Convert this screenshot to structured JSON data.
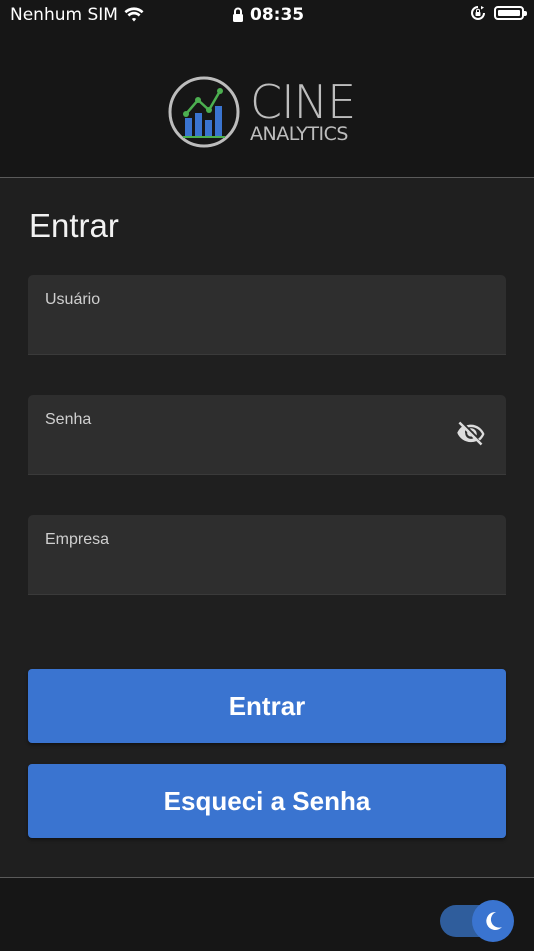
{
  "status_bar": {
    "carrier": "Nenhum SIM",
    "time": "08:35",
    "icons": [
      "wifi-icon",
      "lock-icon",
      "rotation-lock-icon",
      "battery-icon"
    ]
  },
  "brand": {
    "line1": "CINE",
    "line2": "ANALYTICS",
    "logo_icon": "bar-chart-logo-icon",
    "text_color": "#bdbdbd"
  },
  "login": {
    "title": "Entrar",
    "fields": {
      "username": {
        "label": "Usuário",
        "value": ""
      },
      "password": {
        "label": "Senha",
        "value": "",
        "toggle_icon": "eye-off-icon"
      },
      "company": {
        "label": "Empresa",
        "value": ""
      }
    },
    "buttons": {
      "submit": "Entrar",
      "forgot": "Esqueci a Senha"
    }
  },
  "footer": {
    "theme_toggle": {
      "state": "dark",
      "icon": "moon-icon"
    }
  },
  "colors": {
    "background": "#1f1f1f",
    "header": "#161616",
    "field": "#2e2e2e",
    "accent": "#3a74d0"
  }
}
